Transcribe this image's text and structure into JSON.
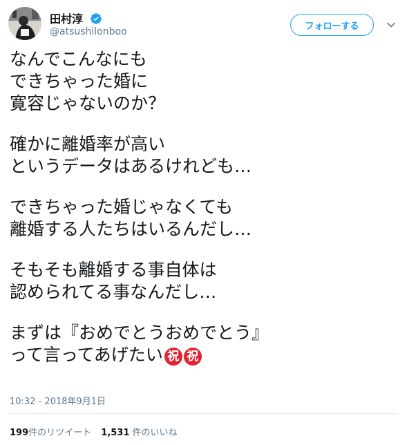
{
  "user": {
    "display_name": "田村淳",
    "handle": "@atsushilonboo",
    "verified": true
  },
  "follow_button": {
    "label": "フォローする"
  },
  "tweet": {
    "paragraphs": [
      [
        "なんでこんなにも",
        "できちゃった婚に",
        "寛容じゃないのか？"
      ],
      [
        "確かに離婚率が高い",
        "というデータはあるけれども…"
      ],
      [
        "できちゃった婚じゃなくても",
        "離婚する人たちはいるんだし…"
      ],
      [
        "そもそも離婚する事自体は",
        "認められてる事なんだし…"
      ],
      [
        "まずは『おめでとうおめでとう』",
        "って言ってあげたい"
      ]
    ],
    "emojis": [
      "祝",
      "祝"
    ],
    "timestamp": "10:32 - 2018年9月1日"
  },
  "stats": {
    "retweet_count": "199",
    "retweet_label": "件のリツイート",
    "like_count": "1,531",
    "like_label": " 件のいいね"
  },
  "colors": {
    "accent": "#1da1f2",
    "muted": "#657786",
    "text": "#14171a",
    "emoji_bg": "#e02434"
  },
  "icons": {
    "verified": "verified-badge-icon",
    "caret": "chevron-down-icon",
    "avatar": "user-avatar"
  }
}
